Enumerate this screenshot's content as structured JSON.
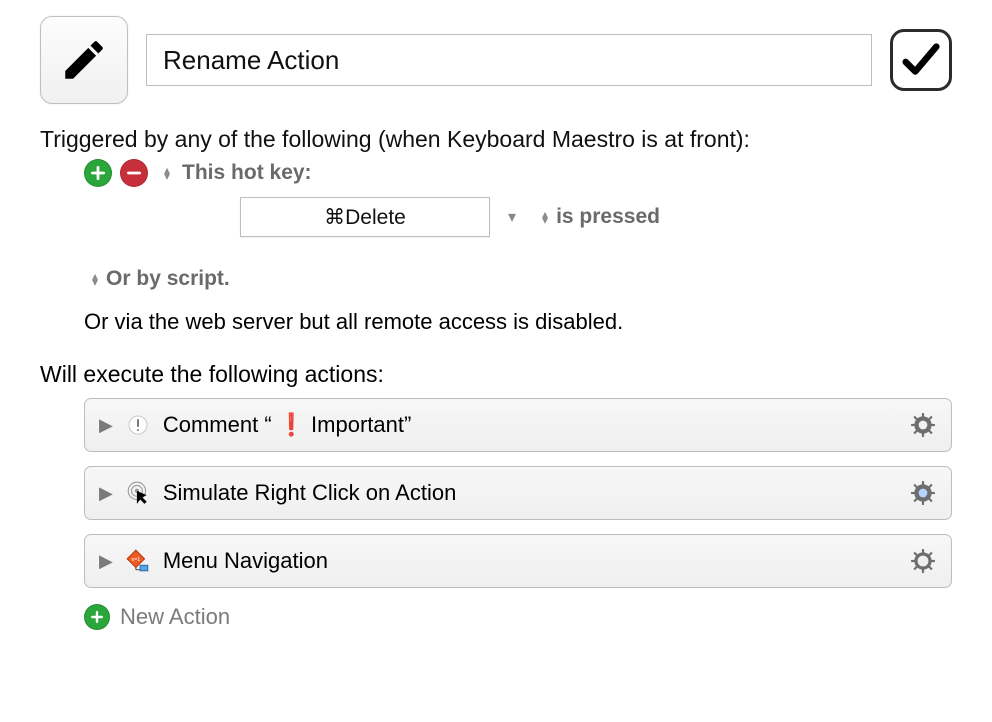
{
  "macro": {
    "name": "Rename Action",
    "enabled": true
  },
  "triggers": {
    "intro": "Triggered by any of the following (when Keyboard Maestro is at front):",
    "type_label": "This hot key:",
    "hotkey_display": "⌘Delete",
    "condition_label": "is pressed",
    "or_script_label": "Or by script.",
    "or_webserver_text": "Or via the web server but all remote access is disabled."
  },
  "execute_label": "Will execute the following actions:",
  "actions": [
    {
      "title_prefix": "Comment “",
      "title_excl": " Important”",
      "icon": "exclaim",
      "gear": "plain"
    },
    {
      "title": "Simulate Right Click on Action",
      "icon": "cursor-target",
      "gear": "blue"
    },
    {
      "title": "Menu Navigation",
      "icon": "flow-diamond",
      "gear": "clock"
    }
  ],
  "new_action_label": "New Action"
}
